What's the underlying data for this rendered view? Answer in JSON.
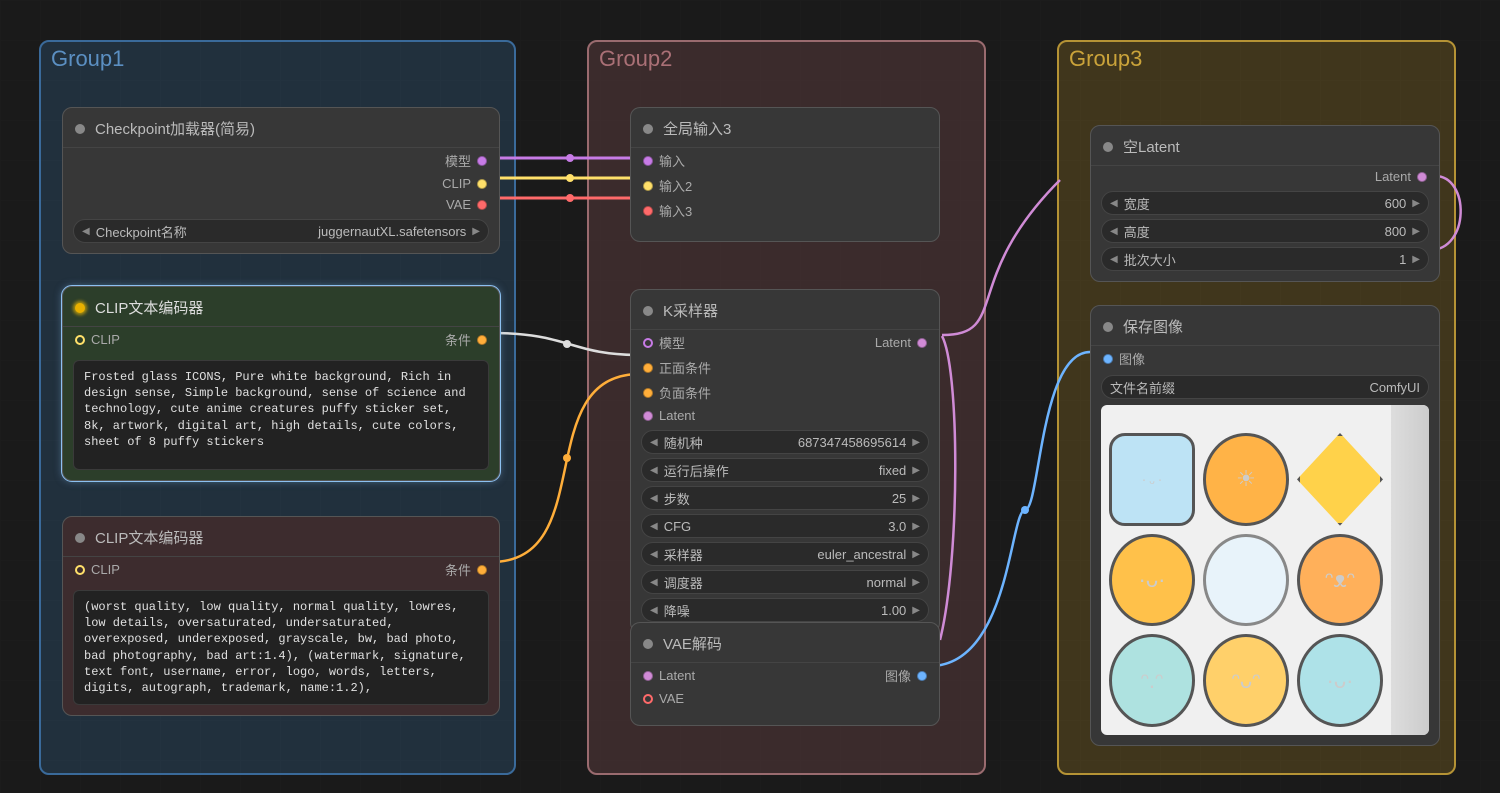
{
  "groups": {
    "g1": "Group1",
    "g2": "Group2",
    "g3": "Group3"
  },
  "checkpoint": {
    "title": "Checkpoint加载器(简易)",
    "out_model": "模型",
    "out_clip": "CLIP",
    "out_vae": "VAE",
    "ckpt_label": "Checkpoint名称",
    "ckpt_value": "juggernautXL.safetensors"
  },
  "clip_pos": {
    "title": "CLIP文本编码器",
    "in_clip": "CLIP",
    "out_cond": "条件",
    "text": "Frosted glass ICONS, Pure white background, Rich in design sense, Simple background, sense of science and technology, cute anime creatures puffy sticker set, 8k, artwork, digital art, high details, cute colors, sheet of 8 puffy stickers"
  },
  "clip_neg": {
    "title": "CLIP文本编码器",
    "in_clip": "CLIP",
    "out_cond": "条件",
    "text": "(worst quality, low quality, normal quality, lowres, low details, oversaturated, undersaturated, overexposed, underexposed, grayscale, bw, bad photo, bad photography, bad art:1.4), (watermark, signature, text font, username, error, logo, words, letters, digits, autograph, trademark, name:1.2),"
  },
  "reroute": {
    "title": "全局输入3",
    "in1": "输入",
    "in2": "输入2",
    "in3": "输入3"
  },
  "ksampler": {
    "title": "K采样器",
    "in_model": "模型",
    "in_pos": "正面条件",
    "in_neg": "负面条件",
    "in_latent": "Latent",
    "out_latent": "Latent",
    "seed_l": "随机种",
    "seed_v": "687347458695614",
    "after_l": "运行后操作",
    "after_v": "fixed",
    "steps_l": "步数",
    "steps_v": "25",
    "cfg_l": "CFG",
    "cfg_v": "3.0",
    "sampler_l": "采样器",
    "sampler_v": "euler_ancestral",
    "sched_l": "调度器",
    "sched_v": "normal",
    "denoise_l": "降噪",
    "denoise_v": "1.00"
  },
  "vaedec": {
    "title": "VAE解码",
    "in_latent": "Latent",
    "in_vae": "VAE",
    "out_img": "图像"
  },
  "empty": {
    "title": "空Latent",
    "out_latent": "Latent",
    "w_l": "宽度",
    "w_v": "600",
    "h_l": "高度",
    "h_v": "800",
    "b_l": "批次大小",
    "b_v": "1"
  },
  "save": {
    "title": "保存图像",
    "in_img": "图像",
    "prefix_l": "文件名前缀",
    "prefix_v": "ComfyUI"
  }
}
